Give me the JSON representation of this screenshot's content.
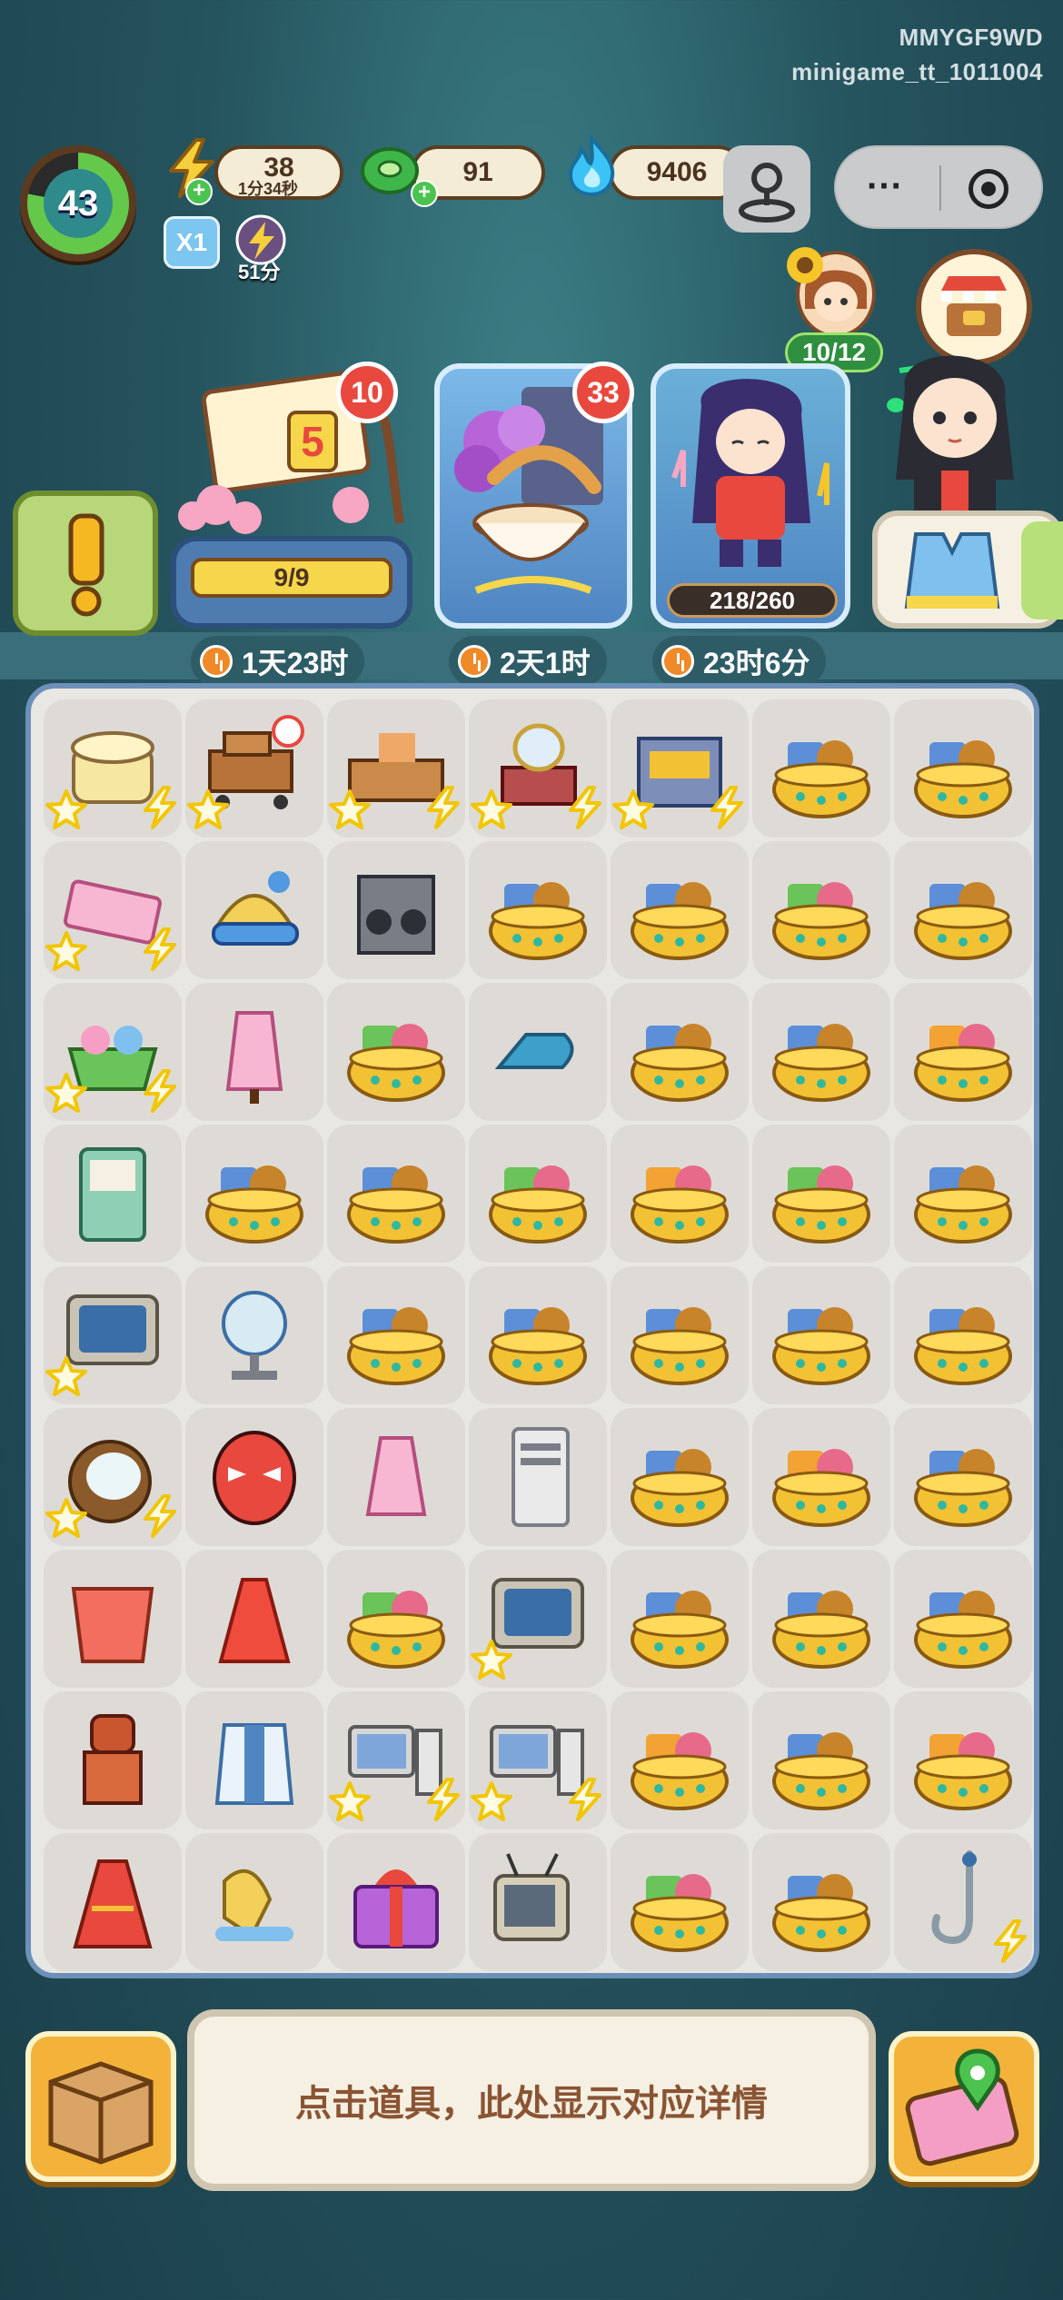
{
  "hud": {
    "game_id": "MMYGF9WD",
    "channel": "minigame_tt_1011004"
  },
  "player": {
    "level": "43",
    "level_progress": 0.78
  },
  "resources": {
    "energy": {
      "value": "38",
      "timer": "1分34秒",
      "icon": "lightning-icon"
    },
    "cash": {
      "value": "91",
      "icon": "green-coin-icon"
    },
    "gems": {
      "value": "9406",
      "icon": "blue-flame-icon"
    }
  },
  "boosts": {
    "multiplier": "X1",
    "energy_boost_timer": "51分"
  },
  "character": {
    "progress": "10/12"
  },
  "orders": [
    {
      "name": "theater-ticket",
      "badge": "10",
      "ticket_number": "5",
      "progress": "9/9",
      "progress_value": 1.0,
      "timer": "1天23时"
    },
    {
      "name": "tea-event",
      "badge": "33",
      "timer": "2天1时"
    },
    {
      "name": "singer-event",
      "progress": "218/260",
      "progress_value": 0.838,
      "timer": "23时6分"
    }
  ],
  "board": {
    "rows": [
      [
        "tablecloth-table",
        "luggage-cart",
        "workbench",
        "vanity-table",
        "kiosk",
        "treasure-basket",
        "treasure-basket"
      ],
      [
        "ticket-box",
        "knit-hat",
        "speakers",
        "treasure-basket",
        "treasure-basket",
        "treasure-basket-jade",
        "treasure-basket"
      ],
      [
        "yarn-basket",
        "qipao-dress",
        "treasure-basket-jade",
        "steam-iron",
        "treasure-basket",
        "treasure-basket",
        "treasure-basket-bell"
      ],
      [
        "vending-fridge",
        "treasure-basket",
        "treasure-basket",
        "treasure-basket-jade",
        "treasure-basket-bell",
        "treasure-basket-jade",
        "treasure-basket"
      ],
      [
        "crt-monitor",
        "desk-fan",
        "treasure-basket",
        "treasure-basket",
        "treasure-basket",
        "treasure-basket",
        "treasure-basket"
      ],
      [
        "coconut",
        "opera-mask",
        "pink-qipao",
        "server-tower",
        "treasure-basket",
        "treasure-basket-bell",
        "treasure-basket"
      ],
      [
        "red-robe",
        "red-dress",
        "treasure-basket-jade",
        "crt-monitor",
        "treasure-basket",
        "treasure-basket",
        "treasure-basket"
      ],
      [
        "armor-costume",
        "hanfu-costume",
        "desktop-pc",
        "desktop-pc",
        "treasure-basket-bell",
        "treasure-basket",
        "treasure-basket-bell"
      ],
      [
        "gold-embroidered-dress",
        "gloves-pair",
        "gift-box",
        "vintage-tv",
        "treasure-basket-jade",
        "treasure-basket",
        "fishing-hook"
      ]
    ]
  },
  "detail_panel": {
    "text": "点击道具，此处显示对应详情"
  }
}
